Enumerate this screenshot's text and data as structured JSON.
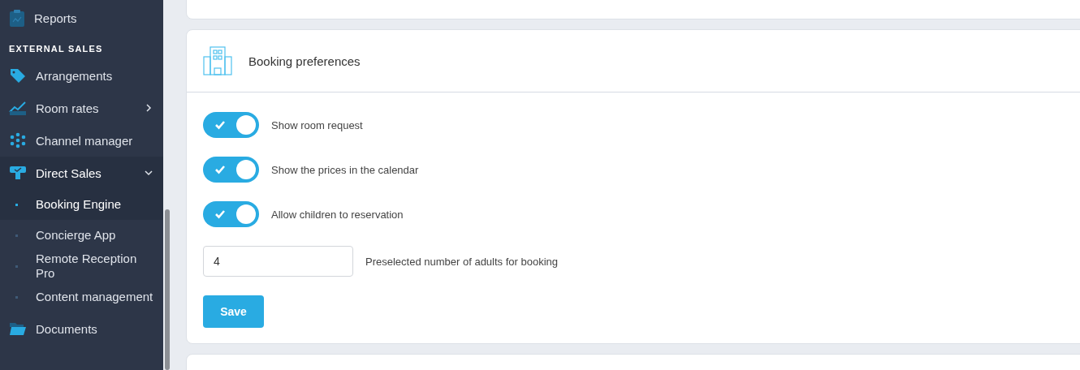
{
  "sidebar": {
    "items": [
      {
        "kind": "item",
        "label": "Reports",
        "selected": false
      },
      {
        "kind": "section",
        "label": "EXTERNAL SALES"
      },
      {
        "kind": "item",
        "label": "Arrangements",
        "selected": false
      },
      {
        "kind": "item",
        "label": "Room rates",
        "selected": false,
        "expanded": false
      },
      {
        "kind": "item",
        "label": "Channel manager",
        "selected": false
      },
      {
        "kind": "item",
        "label": "Direct Sales",
        "selected": true,
        "expanded": true,
        "children": [
          {
            "label": "Booking Engine",
            "selected": true
          },
          {
            "label": "Concierge App",
            "selected": false
          },
          {
            "label": "Remote Reception Pro",
            "selected": false
          },
          {
            "label": "Content management",
            "selected": false
          }
        ]
      },
      {
        "kind": "item",
        "label": "Documents",
        "selected": false
      }
    ]
  },
  "card": {
    "title": "Booking preferences",
    "settings": [
      {
        "kind": "toggle",
        "label": "Show room request",
        "on": true
      },
      {
        "kind": "toggle",
        "label": "Show the prices in the calendar",
        "on": true
      },
      {
        "kind": "toggle",
        "label": "Allow children to reservation",
        "on": true
      },
      {
        "kind": "number",
        "value": "4",
        "label": "Preselected number of adults for booking"
      }
    ],
    "button": "Save"
  }
}
